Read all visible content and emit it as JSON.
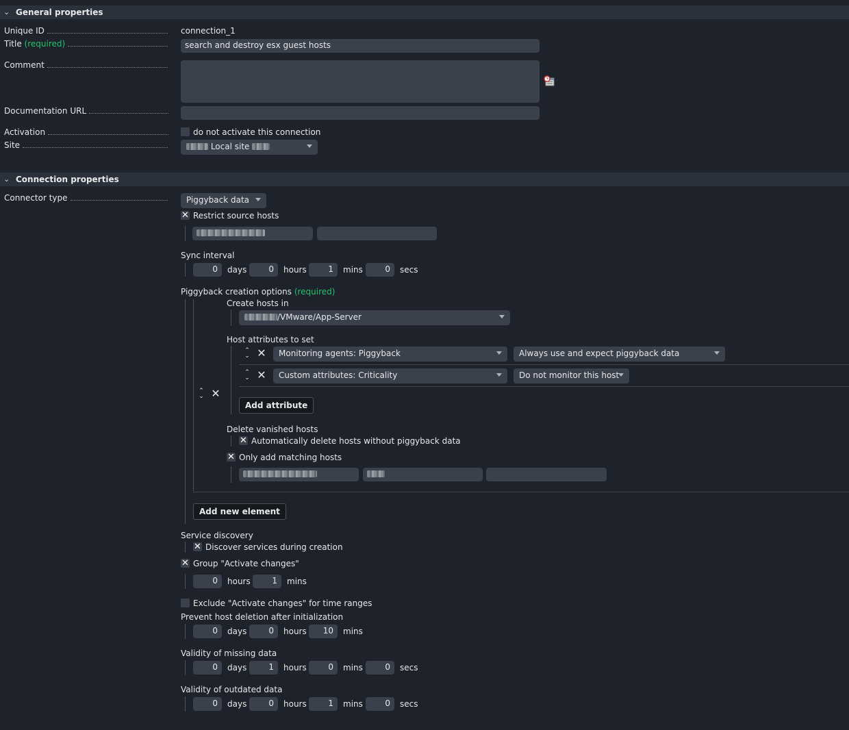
{
  "general": {
    "header": "General properties",
    "unique_id_label": "Unique ID",
    "unique_id_value": "connection_1",
    "title_label": "Title",
    "title_required": "(required)",
    "title_value": "search and destroy esx guest hosts",
    "comment_label": "Comment",
    "doc_url_label": "Documentation URL",
    "activation_label": "Activation",
    "activation_checkbox": "do not activate this connection",
    "site_label": "Site",
    "site_value": "Local site"
  },
  "connection": {
    "header": "Connection properties",
    "connector_type_label": "Connector type",
    "connector_type_value": "Piggyback data",
    "restrict_source_hosts": "Restrict source hosts",
    "sync_interval_label": "Sync interval",
    "sync_interval": {
      "days": "0",
      "hours": "0",
      "mins": "1",
      "secs": "0"
    },
    "units": {
      "days": "days",
      "hours": "hours",
      "mins": "mins",
      "secs": "secs"
    },
    "piggyback_options_label": "Piggyback creation options",
    "piggyback_required": "(required)",
    "create_hosts_in_label": "Create hosts in",
    "create_hosts_in_value": "/VMware/App-Server",
    "host_attributes_label": "Host attributes to set",
    "attributes": [
      {
        "name": "Monitoring agents: Piggyback",
        "value": "Always use and expect piggyback data"
      },
      {
        "name": "Custom attributes: Criticality",
        "value": "Do not monitor this host"
      }
    ],
    "add_attribute_button": "Add attribute",
    "delete_vanished_label": "Delete vanished hosts",
    "auto_delete_checkbox": "Automatically delete hosts without piggyback data",
    "only_matching_checkbox": "Only add matching hosts",
    "add_new_element_button": "Add new element",
    "service_discovery_label": "Service discovery",
    "discover_services_checkbox": "Discover services during creation",
    "group_activate_checkbox": "Group \"Activate changes\"",
    "group_activate": {
      "hours": "0",
      "mins": "1"
    },
    "exclude_activate_checkbox": "Exclude \"Activate changes\" for time ranges",
    "prevent_deletion_label": "Prevent host deletion after initialization",
    "prevent_deletion": {
      "days": "0",
      "hours": "0",
      "mins": "10"
    },
    "validity_missing_label": "Validity of missing data",
    "validity_missing": {
      "days": "0",
      "hours": "1",
      "mins": "0",
      "secs": "0"
    },
    "validity_outdated_label": "Validity of outdated data",
    "validity_outdated": {
      "days": "0",
      "hours": "0",
      "mins": "1",
      "secs": "0"
    }
  }
}
